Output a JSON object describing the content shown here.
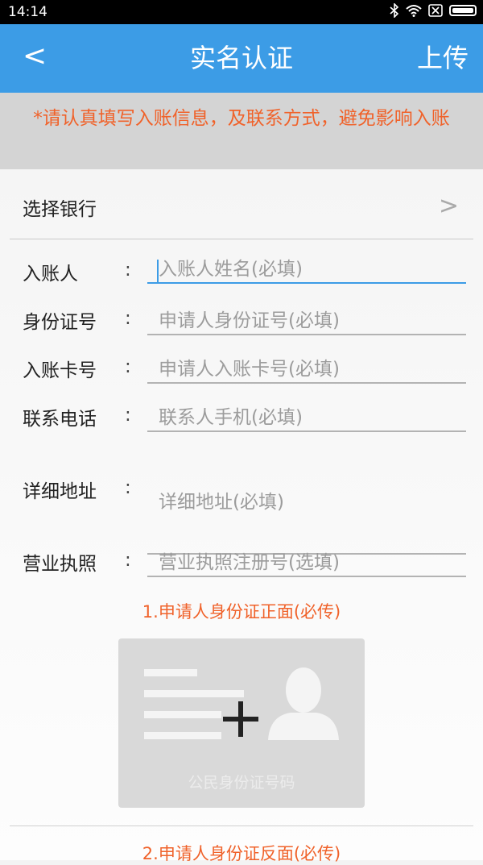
{
  "status_bar": {
    "time": "14:14"
  },
  "app_bar": {
    "back": "<",
    "title": "实名认证",
    "upload": "上传"
  },
  "notice": "*请认真填写入账信息，及联系方式，避免影响入账",
  "bank": {
    "label": "选择银行",
    "chevron": ">"
  },
  "fields": [
    {
      "label": "入账人",
      "placeholder": "入账人姓名(必填)"
    },
    {
      "label": "身份证号",
      "placeholder": "申请人身份证号(必填)"
    },
    {
      "label": "入账卡号",
      "placeholder": "申请人入账卡号(必填)"
    },
    {
      "label": "联系电话",
      "placeholder": "联系人手机(必填)"
    },
    {
      "label": "详细地址",
      "placeholder": "详细地址(必填)"
    },
    {
      "label": "营业执照",
      "placeholder": "营业执照注册号(选填)"
    }
  ],
  "colon": ":",
  "uploads": [
    {
      "label": "1.申请人身份证正面(必传)",
      "card_caption": "公民身份证号码"
    },
    {
      "label": "2.申请人身份证反面(必传)"
    }
  ],
  "colors": {
    "accent": "#3c9ce6",
    "warning": "#f0622a"
  }
}
